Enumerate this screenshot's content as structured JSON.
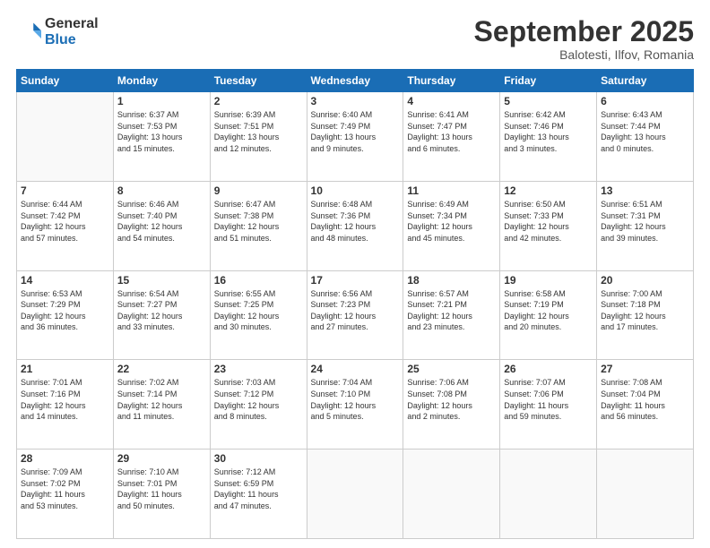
{
  "header": {
    "logo_general": "General",
    "logo_blue": "Blue",
    "month_title": "September 2025",
    "subtitle": "Balotesti, Ilfov, Romania"
  },
  "weekdays": [
    "Sunday",
    "Monday",
    "Tuesday",
    "Wednesday",
    "Thursday",
    "Friday",
    "Saturday"
  ],
  "weeks": [
    [
      {
        "day": "",
        "info": ""
      },
      {
        "day": "1",
        "info": "Sunrise: 6:37 AM\nSunset: 7:53 PM\nDaylight: 13 hours\nand 15 minutes."
      },
      {
        "day": "2",
        "info": "Sunrise: 6:39 AM\nSunset: 7:51 PM\nDaylight: 13 hours\nand 12 minutes."
      },
      {
        "day": "3",
        "info": "Sunrise: 6:40 AM\nSunset: 7:49 PM\nDaylight: 13 hours\nand 9 minutes."
      },
      {
        "day": "4",
        "info": "Sunrise: 6:41 AM\nSunset: 7:47 PM\nDaylight: 13 hours\nand 6 minutes."
      },
      {
        "day": "5",
        "info": "Sunrise: 6:42 AM\nSunset: 7:46 PM\nDaylight: 13 hours\nand 3 minutes."
      },
      {
        "day": "6",
        "info": "Sunrise: 6:43 AM\nSunset: 7:44 PM\nDaylight: 13 hours\nand 0 minutes."
      }
    ],
    [
      {
        "day": "7",
        "info": "Sunrise: 6:44 AM\nSunset: 7:42 PM\nDaylight: 12 hours\nand 57 minutes."
      },
      {
        "day": "8",
        "info": "Sunrise: 6:46 AM\nSunset: 7:40 PM\nDaylight: 12 hours\nand 54 minutes."
      },
      {
        "day": "9",
        "info": "Sunrise: 6:47 AM\nSunset: 7:38 PM\nDaylight: 12 hours\nand 51 minutes."
      },
      {
        "day": "10",
        "info": "Sunrise: 6:48 AM\nSunset: 7:36 PM\nDaylight: 12 hours\nand 48 minutes."
      },
      {
        "day": "11",
        "info": "Sunrise: 6:49 AM\nSunset: 7:34 PM\nDaylight: 12 hours\nand 45 minutes."
      },
      {
        "day": "12",
        "info": "Sunrise: 6:50 AM\nSunset: 7:33 PM\nDaylight: 12 hours\nand 42 minutes."
      },
      {
        "day": "13",
        "info": "Sunrise: 6:51 AM\nSunset: 7:31 PM\nDaylight: 12 hours\nand 39 minutes."
      }
    ],
    [
      {
        "day": "14",
        "info": "Sunrise: 6:53 AM\nSunset: 7:29 PM\nDaylight: 12 hours\nand 36 minutes."
      },
      {
        "day": "15",
        "info": "Sunrise: 6:54 AM\nSunset: 7:27 PM\nDaylight: 12 hours\nand 33 minutes."
      },
      {
        "day": "16",
        "info": "Sunrise: 6:55 AM\nSunset: 7:25 PM\nDaylight: 12 hours\nand 30 minutes."
      },
      {
        "day": "17",
        "info": "Sunrise: 6:56 AM\nSunset: 7:23 PM\nDaylight: 12 hours\nand 27 minutes."
      },
      {
        "day": "18",
        "info": "Sunrise: 6:57 AM\nSunset: 7:21 PM\nDaylight: 12 hours\nand 23 minutes."
      },
      {
        "day": "19",
        "info": "Sunrise: 6:58 AM\nSunset: 7:19 PM\nDaylight: 12 hours\nand 20 minutes."
      },
      {
        "day": "20",
        "info": "Sunrise: 7:00 AM\nSunset: 7:18 PM\nDaylight: 12 hours\nand 17 minutes."
      }
    ],
    [
      {
        "day": "21",
        "info": "Sunrise: 7:01 AM\nSunset: 7:16 PM\nDaylight: 12 hours\nand 14 minutes."
      },
      {
        "day": "22",
        "info": "Sunrise: 7:02 AM\nSunset: 7:14 PM\nDaylight: 12 hours\nand 11 minutes."
      },
      {
        "day": "23",
        "info": "Sunrise: 7:03 AM\nSunset: 7:12 PM\nDaylight: 12 hours\nand 8 minutes."
      },
      {
        "day": "24",
        "info": "Sunrise: 7:04 AM\nSunset: 7:10 PM\nDaylight: 12 hours\nand 5 minutes."
      },
      {
        "day": "25",
        "info": "Sunrise: 7:06 AM\nSunset: 7:08 PM\nDaylight: 12 hours\nand 2 minutes."
      },
      {
        "day": "26",
        "info": "Sunrise: 7:07 AM\nSunset: 7:06 PM\nDaylight: 11 hours\nand 59 minutes."
      },
      {
        "day": "27",
        "info": "Sunrise: 7:08 AM\nSunset: 7:04 PM\nDaylight: 11 hours\nand 56 minutes."
      }
    ],
    [
      {
        "day": "28",
        "info": "Sunrise: 7:09 AM\nSunset: 7:02 PM\nDaylight: 11 hours\nand 53 minutes."
      },
      {
        "day": "29",
        "info": "Sunrise: 7:10 AM\nSunset: 7:01 PM\nDaylight: 11 hours\nand 50 minutes."
      },
      {
        "day": "30",
        "info": "Sunrise: 7:12 AM\nSunset: 6:59 PM\nDaylight: 11 hours\nand 47 minutes."
      },
      {
        "day": "",
        "info": ""
      },
      {
        "day": "",
        "info": ""
      },
      {
        "day": "",
        "info": ""
      },
      {
        "day": "",
        "info": ""
      }
    ]
  ]
}
